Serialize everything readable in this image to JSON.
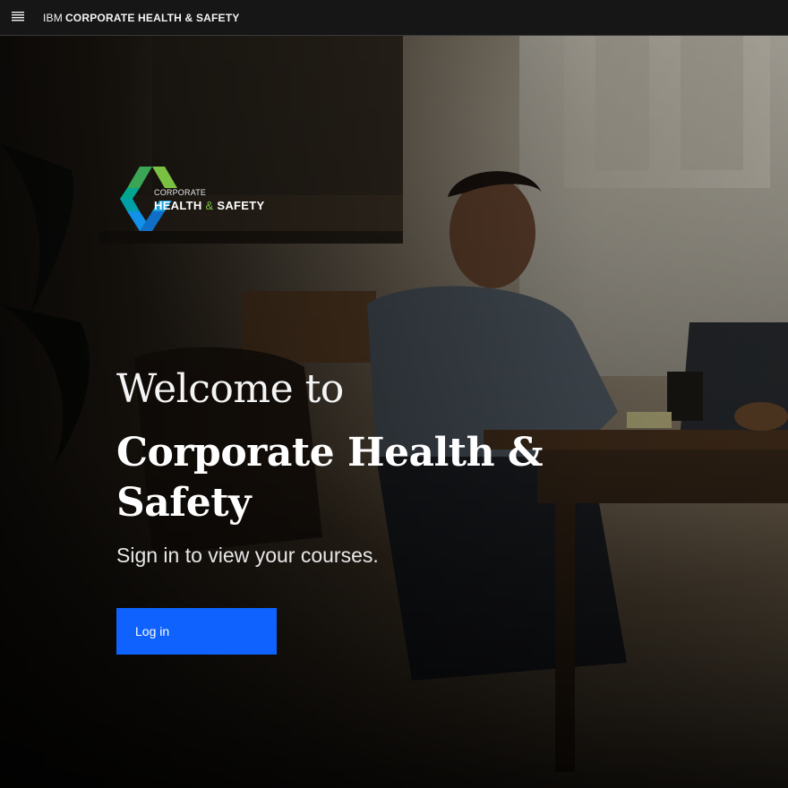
{
  "header": {
    "brand_prefix": "IBM",
    "brand_name": "CORPORATE HEALTH & SAFETY",
    "menu_icon": "hamburger-menu-icon"
  },
  "logo": {
    "line1": "CORPORATE",
    "line2_part1": "HEALTH",
    "line2_amp": "&",
    "line2_part2": "SAFETY",
    "colors": [
      "#7ac143",
      "#00a78e",
      "#1192e8"
    ]
  },
  "hero": {
    "welcome": "Welcome to",
    "title": "Corporate Health & Safety",
    "subtitle": "Sign in to view your courses.",
    "login_label": "Log in"
  },
  "colors": {
    "header_bg": "#161616",
    "primary_button": "#0f62fe",
    "text_primary": "#ffffff"
  }
}
